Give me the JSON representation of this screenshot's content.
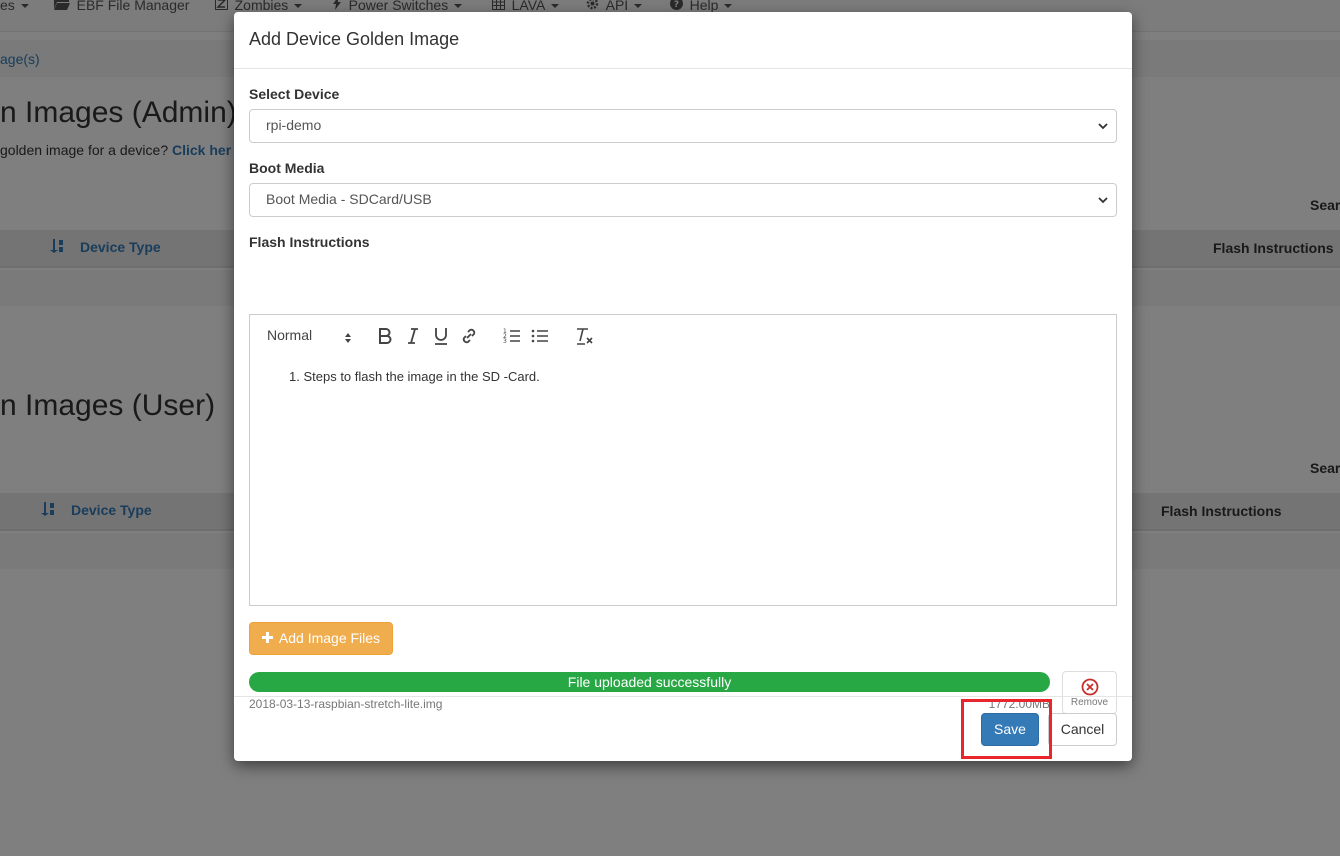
{
  "nav": {
    "items": [
      {
        "label": "es",
        "icon": ""
      },
      {
        "label": "EBF File Manager",
        "icon": "folder-open-icon"
      },
      {
        "label": "Zombies",
        "icon": "zombie-z-icon"
      },
      {
        "label": "Power Switches",
        "icon": "bolt-icon"
      },
      {
        "label": "LAVA",
        "icon": "table-icon"
      },
      {
        "label": "API",
        "icon": "gear-icon"
      },
      {
        "label": "Help",
        "icon": "question-circle-icon"
      }
    ]
  },
  "breadcrumb": "age(s)",
  "admin_section": {
    "title": "n Images (Admin)",
    "subtext": " golden image for a device?",
    "link": "Click her",
    "search": "Sear",
    "col_device_type": "Device Type",
    "col_flash": "Flash Instructions"
  },
  "user_section": {
    "title": "n Images (User)",
    "search": "Sear",
    "col_device_type": "Device Type",
    "col_flash": "Flash Instructions"
  },
  "modal": {
    "title": "Add Device Golden Image",
    "select_device_label": "Select Device",
    "select_device_value": "rpi-demo",
    "boot_media_label": "Boot Media",
    "boot_media_value": "Boot Media - SDCard/USB",
    "flash_label": "Flash Instructions",
    "toolbar": {
      "font_size": "Normal",
      "buttons": [
        "bold-icon",
        "italic-icon",
        "underline-icon",
        "link-icon",
        "ordered-list-icon",
        "bullet-list-icon",
        "clear-format-icon"
      ]
    },
    "editor_text": "Steps to flash the image in the SD -Card.",
    "add_files_label": "Add Image Files",
    "upload": {
      "progress_label": "File uploaded successfully",
      "progress_percent": 100,
      "file_name": "2018-03-13-raspbian-stretch-lite.img",
      "file_size": "1772.00MB",
      "remove_label": "Remove"
    },
    "save_label": "Save",
    "cancel_label": "Cancel"
  },
  "colors": {
    "primary": "#337ab7",
    "warning": "#f0ad4e",
    "success": "#28a745",
    "highlight": "#e8262b",
    "danger": "#c9302c"
  }
}
